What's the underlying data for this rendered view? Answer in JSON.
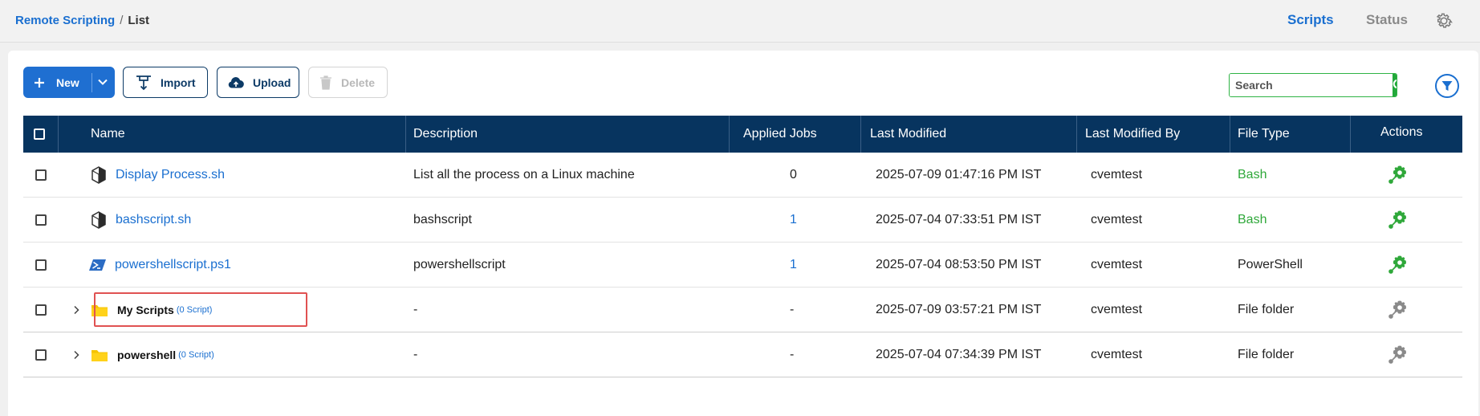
{
  "breadcrumb": {
    "root": "Remote Scripting",
    "separator": "/",
    "current": "List"
  },
  "topnav": {
    "scripts": "Scripts",
    "status": "Status"
  },
  "toolbar": {
    "new": "New",
    "import": "Import",
    "upload": "Upload",
    "delete": "Delete"
  },
  "search": {
    "placeholder": "Search"
  },
  "table": {
    "headers": {
      "name": "Name",
      "description": "Description",
      "applied_jobs": "Applied Jobs",
      "last_modified": "Last Modified",
      "last_modified_by": "Last Modified By",
      "file_type": "File Type",
      "actions": "Actions"
    },
    "rows": [
      {
        "name": "Display Process.sh",
        "description": "List all the process on a Linux machine",
        "applied_jobs": "0",
        "last_modified": "2025-07-09 01:47:16 PM IST",
        "last_modified_by": "cvemtest",
        "file_type": "Bash",
        "icon": "bash-script-icon"
      },
      {
        "name": "bashscript.sh",
        "description": "bashscript",
        "applied_jobs": "1",
        "last_modified": "2025-07-04 07:33:51 PM IST",
        "last_modified_by": "cvemtest",
        "file_type": "Bash",
        "icon": "bash-script-icon"
      },
      {
        "name": "powershellscript.ps1",
        "description": "powershellscript",
        "applied_jobs": "1",
        "last_modified": "2025-07-04 08:53:50 PM IST",
        "last_modified_by": "cvemtest",
        "file_type": "PowerShell",
        "icon": "powershell-script-icon"
      },
      {
        "name": "My Scripts",
        "count": "(0 Script)",
        "description": "-",
        "applied_jobs": "-",
        "last_modified": "2025-07-09 03:57:21 PM IST",
        "last_modified_by": "cvemtest",
        "file_type": "File folder",
        "icon": "folder-icon"
      },
      {
        "name": "powershell",
        "count": "(0 Script)",
        "description": "-",
        "applied_jobs": "-",
        "last_modified": "2025-07-04 07:34:39 PM IST",
        "last_modified_by": "cvemtest",
        "file_type": "File folder",
        "icon": "folder-icon"
      }
    ]
  },
  "colors": {
    "primary": "#1f6fd1",
    "header_bg": "#07345f",
    "bash_green": "#2fa83a",
    "link_blue": "#1a6fd0",
    "highlight_red": "#e05252",
    "folder_yellow": "#f6c300"
  }
}
